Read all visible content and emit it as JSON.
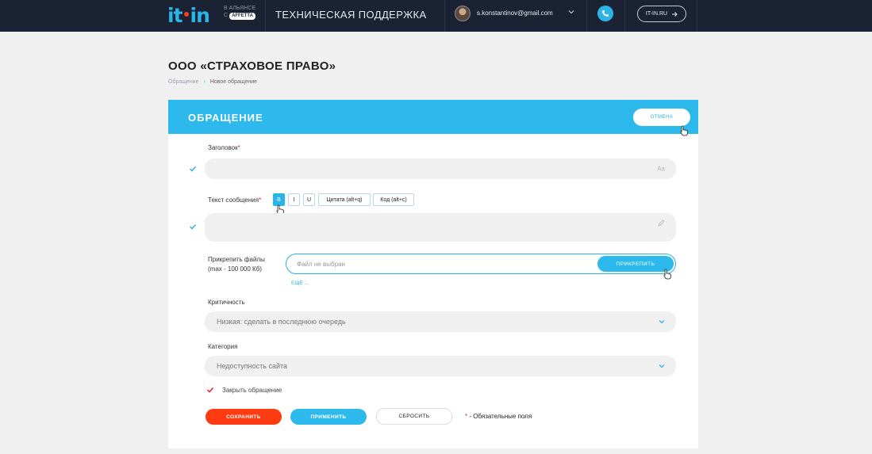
{
  "header": {
    "logo_left": "it",
    "logo_right": "in",
    "alliance_line1": "в альянсе",
    "alliance_line2": "с",
    "alliance_brand": "affetta",
    "site_title": "ТЕХНИЧЕСКАЯ ПОДДЕРЖКА",
    "user_email": "s.konstantinov@gmail.com",
    "site_button": "IT-IN.RU"
  },
  "page": {
    "title": "ООО «СТРАХОВОЕ ПРАВО»",
    "breadcrumb": [
      "Обращение",
      "Новое обращение"
    ],
    "breadcrumb_sep": "›"
  },
  "form": {
    "title": "ОБРАЩЕНИЕ",
    "cancel": "ОТМЕНА",
    "subject_label": "Заголовок",
    "subject_value": "",
    "subject_icon": "Aa",
    "message_label": "Текст сообщения",
    "message_value": "",
    "required_mark": "*",
    "format_buttons": {
      "bold": "B",
      "italic": "I",
      "underline": "U",
      "quote": "Цитата (alt+q)",
      "code": "Код (alt+c)"
    },
    "attach_label_line1": "Прикрепить файлы",
    "attach_label_line2": "(max - 100 000 Кб)",
    "file_placeholder": "Файл не выбран",
    "attach_button": "ПРИКРЕПИТЬ",
    "more_link": "ЕЩЕ ...",
    "priority_label": "Критичность",
    "priority_value": "Низкая: сделать в последнюю очередь",
    "category_label": "Категория",
    "category_value": "Недоступность сайта",
    "close_label": "Закрыть обращение",
    "save": "СОХРАНИТЬ",
    "apply": "ПРИМЕНИТЬ",
    "reset": "СБРОСИТЬ",
    "required_note": " - Обязательные поля"
  },
  "colors": {
    "accent": "#2eb9ec",
    "danger": "#ff3b12",
    "topbar": "#1a2233"
  }
}
